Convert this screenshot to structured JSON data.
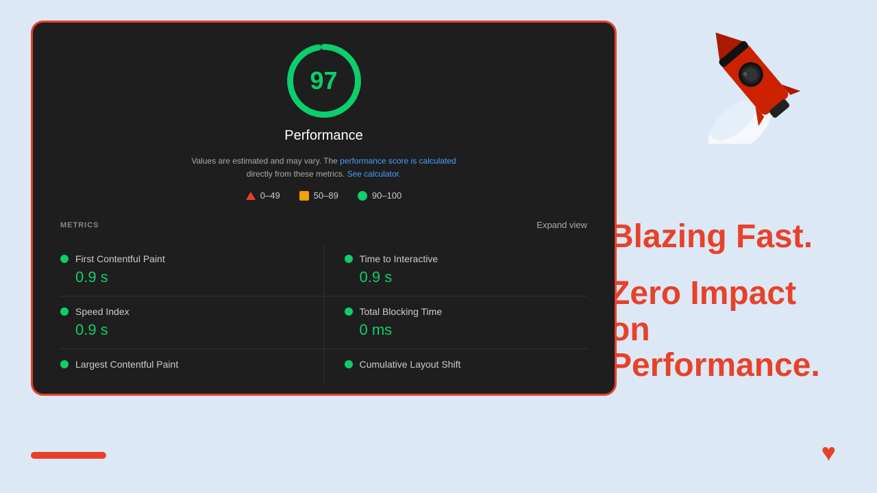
{
  "background_color": "#dce8f5",
  "card": {
    "score": "97",
    "score_label": "Performance",
    "description_text": "Values are estimated and may vary. The ",
    "description_link1": "performance score is calculated",
    "description_middle": "directly from these metrics.",
    "description_link2": "See calculator.",
    "legend": [
      {
        "range": "0–49",
        "type": "red"
      },
      {
        "range": "50–89",
        "type": "orange"
      },
      {
        "range": "90–100",
        "type": "green"
      }
    ],
    "metrics_title": "METRICS",
    "expand_label": "Expand view",
    "metrics": [
      {
        "name": "First Contentful Paint",
        "value": "0.9 s"
      },
      {
        "name": "Time to Interactive",
        "value": "0.9 s"
      },
      {
        "name": "Speed Index",
        "value": "0.9 s"
      },
      {
        "name": "Total Blocking Time",
        "value": "0 ms"
      },
      {
        "name": "Largest Contentful Paint",
        "value": ""
      },
      {
        "name": "Cumulative Layout Shift",
        "value": ""
      }
    ]
  },
  "right_text": {
    "blazing_fast": "Blazing Fast.",
    "zero_impact": "Zero Impact on Performance."
  },
  "bottom_heart": "♥"
}
